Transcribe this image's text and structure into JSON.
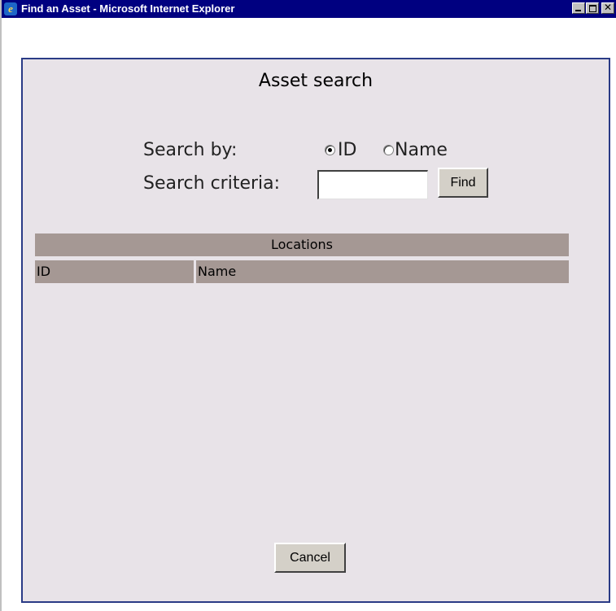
{
  "window": {
    "title": "Find an Asset - Microsoft Internet Explorer",
    "icon": "internet-explorer-icon"
  },
  "page": {
    "heading": "Asset search",
    "search_by_label": "Search by:",
    "options": [
      {
        "label": "ID",
        "checked": true
      },
      {
        "label": "Name",
        "checked": false
      }
    ],
    "criteria_label": "Search criteria:",
    "criteria_value": "",
    "find_label": "Find",
    "cancel_label": "Cancel"
  },
  "table": {
    "title": "Locations",
    "columns": [
      "ID",
      "Name"
    ],
    "rows": []
  },
  "colors": {
    "titlebar": "#000080",
    "panel_background": "#e8e3e8",
    "panel_border": "#2a3b86",
    "table_header": "#a59894"
  }
}
